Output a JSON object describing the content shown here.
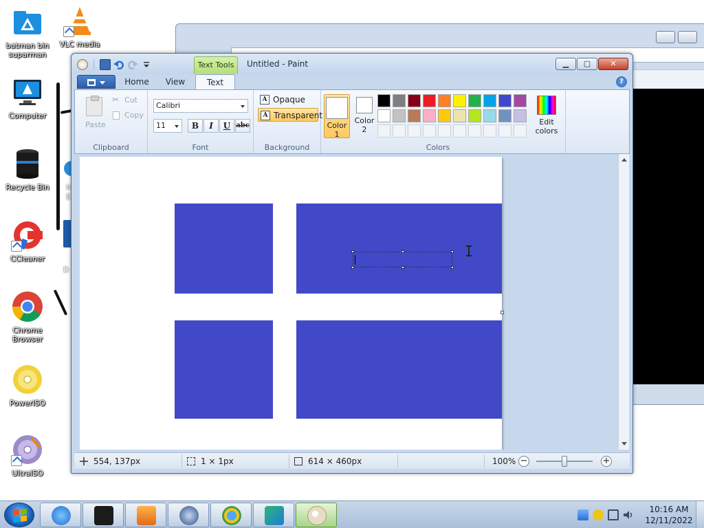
{
  "desktop": {
    "icons": [
      {
        "label": "batman bin suparman",
        "icon": "folder-icon"
      },
      {
        "label": "VLC media",
        "icon": "vlc-icon"
      },
      {
        "label": "Computer",
        "icon": "computer-icon"
      },
      {
        "label": "Recycle Bin",
        "icon": "recycle-bin-icon"
      },
      {
        "label": "CCleaner",
        "icon": "ccleaner-icon"
      },
      {
        "label": "Chrome Browser",
        "icon": "chrome-icon"
      },
      {
        "label": "PowerISO",
        "icon": "poweriso-icon"
      },
      {
        "label": "UltraISO",
        "icon": "ultraiso-icon"
      }
    ],
    "partial_labels": [
      "In",
      "E",
      "D"
    ]
  },
  "paint": {
    "title": "Untitled - Paint",
    "contextual_tab": "Text Tools",
    "tabs": [
      "Home",
      "View",
      "Text"
    ],
    "active_tab": "Text",
    "ribbon": {
      "clipboard": {
        "label": "Clipboard",
        "paste": "Paste",
        "cut": "Cut",
        "copy": "Copy"
      },
      "font": {
        "label": "Font",
        "family": "Calibri",
        "size": "11",
        "bold": "B",
        "italic": "I",
        "underline": "U",
        "strike": "abc"
      },
      "background": {
        "label": "Background",
        "opaque": "Opaque",
        "transparent": "Transparent",
        "selected": "Transparent"
      },
      "colors": {
        "label": "Colors",
        "color1_label": "Color 1",
        "color2_label": "Color 2",
        "color1": "#ffffff",
        "color2": "#ffffff",
        "edit_colors": "Edit colors",
        "palette_row1": [
          "#000000",
          "#7f7f7f",
          "#880015",
          "#ed1c24",
          "#ff7f27",
          "#fff200",
          "#22b14c",
          "#00a2e8",
          "#3f48cc",
          "#a349a4"
        ],
        "palette_row2": [
          "#ffffff",
          "#c3c3c3",
          "#b97a57",
          "#ffaec9",
          "#ffc90e",
          "#efe4b0",
          "#b5e61d",
          "#99d9ea",
          "#7092be",
          "#c8bfe7"
        ]
      }
    },
    "canvas": {
      "fill_color": "#4149c9",
      "background": "#ffffff"
    },
    "status": {
      "cursor_pos": "554, 137px",
      "selection_size": "1 × 1px",
      "image_size": "614 × 460px",
      "zoom": "100%"
    }
  },
  "taskbar": {
    "apps": [
      "internet-explorer-icon",
      "media-center-icon",
      "media-player-icon",
      "globe-app-icon",
      "browser-app-icon",
      "remote-app-icon",
      "paint-icon"
    ],
    "active_app": "paint-icon",
    "time": "10:16 AM",
    "date": "12/11/2022"
  }
}
